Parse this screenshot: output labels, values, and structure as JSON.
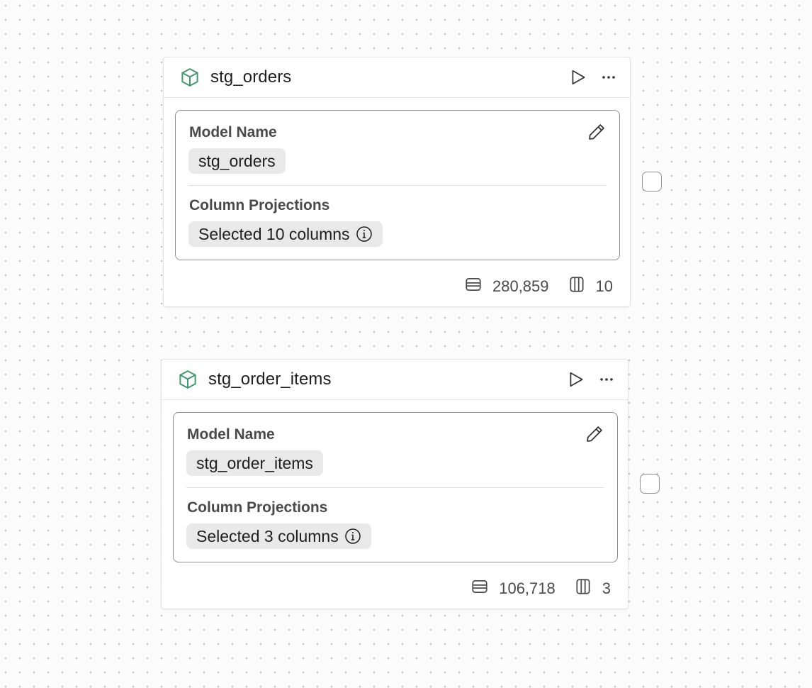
{
  "nodes": [
    {
      "title": "stg_orders",
      "model_name_label": "Model Name",
      "model_name": "stg_orders",
      "projections_label": "Column Projections",
      "projections": "Selected 10 columns",
      "row_count": "280,859",
      "column_count": "10"
    },
    {
      "title": "stg_order_items",
      "model_name_label": "Model Name",
      "model_name": "stg_order_items",
      "projections_label": "Column Projections",
      "projections": "Selected 3 columns",
      "row_count": "106,718",
      "column_count": "3"
    }
  ],
  "icons": {
    "model": "cube-icon",
    "run": "play-icon",
    "more": "more-horizontal-icon",
    "edit": "pencil-icon",
    "info": "info-icon",
    "rows": "rows-icon",
    "columns": "columns-icon"
  },
  "colors": {
    "accent": "#3f9a6e",
    "canvas": "#fcfcfc",
    "chip": "#e9e9e9"
  }
}
